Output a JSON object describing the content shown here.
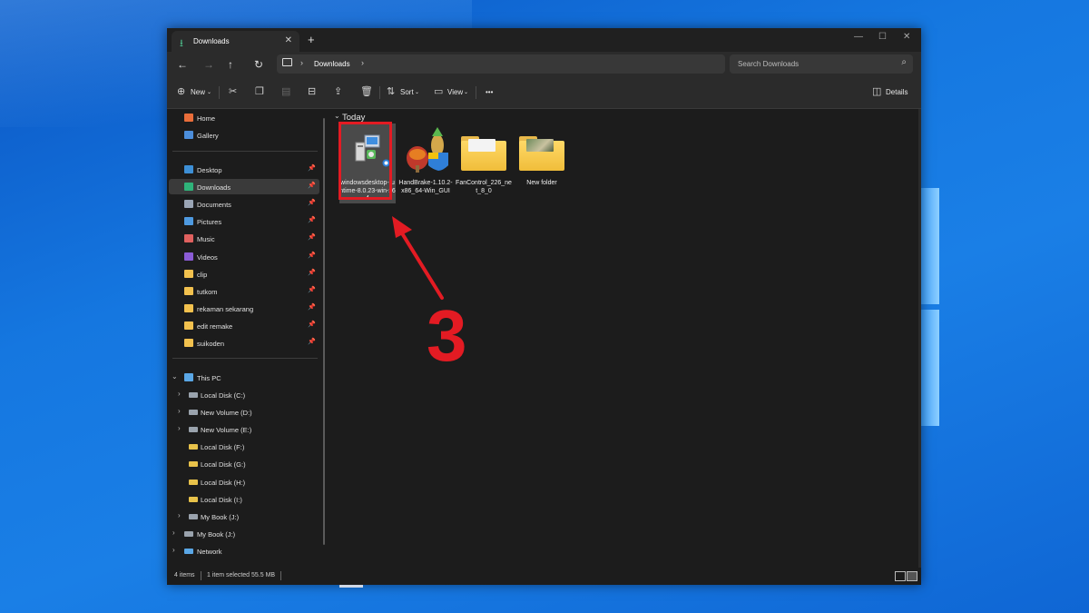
{
  "window": {
    "tab_title": "Downloads",
    "new_tab_glyph": "+",
    "close_glyph": "✕"
  },
  "address": {
    "location": "Downloads",
    "search_placeholder": "Search Downloads"
  },
  "commands": {
    "new_label": "New",
    "sort_label": "Sort",
    "view_label": "View",
    "more_glyph": "•••",
    "details_label": "Details"
  },
  "sidebar": {
    "top": [
      {
        "label": "Home",
        "icon": "home-icon",
        "color": "#e96d3a"
      },
      {
        "label": "Gallery",
        "icon": "gallery-icon",
        "color": "#4c8edb"
      }
    ],
    "quick": [
      {
        "label": "Desktop",
        "icon": "desktop-icon",
        "color": "#3d8fd6"
      },
      {
        "label": "Downloads",
        "icon": "download-icon",
        "color": "#2fb37a",
        "selected": true
      },
      {
        "label": "Documents",
        "icon": "documents-icon",
        "color": "#9aa5b5"
      },
      {
        "label": "Pictures",
        "icon": "pictures-icon",
        "color": "#4e9ae0"
      },
      {
        "label": "Music",
        "icon": "music-icon",
        "color": "#e0615f"
      },
      {
        "label": "Videos",
        "icon": "videos-icon",
        "color": "#8b5cd6"
      },
      {
        "label": "clip",
        "icon": "folder-icon",
        "color": "#f2c14e"
      },
      {
        "label": "tutkom",
        "icon": "folder-icon",
        "color": "#f2c14e"
      },
      {
        "label": "rekaman sekarang",
        "icon": "folder-icon",
        "color": "#f2c14e"
      },
      {
        "label": "edit remake",
        "icon": "folder-icon",
        "color": "#f2c14e"
      },
      {
        "label": "suikoden",
        "icon": "folder-icon",
        "color": "#f2c14e"
      }
    ],
    "this_pc": "This PC",
    "drives": [
      {
        "label": "Local Disk (C:)",
        "icon": "drive-icon",
        "expandable": true
      },
      {
        "label": "New Volume (D:)",
        "icon": "drive-icon",
        "expandable": true
      },
      {
        "label": "New Volume (E:)",
        "icon": "drive-icon",
        "expandable": true
      },
      {
        "label": "Local Disk (F:)",
        "icon": "locked-drive-icon",
        "expandable": false
      },
      {
        "label": "Local Disk (G:)",
        "icon": "locked-drive-icon",
        "expandable": false
      },
      {
        "label": "Local Disk (H:)",
        "icon": "locked-drive-icon",
        "expandable": false
      },
      {
        "label": "Local Disk (I:)",
        "icon": "locked-drive-icon",
        "expandable": false
      },
      {
        "label": "My Book (J:)",
        "icon": "drive-icon",
        "expandable": true
      }
    ],
    "bottom": [
      {
        "label": "My Book (J:)",
        "icon": "drive-icon"
      },
      {
        "label": "Network",
        "icon": "network-icon"
      }
    ]
  },
  "content": {
    "group_label": "Today",
    "files": [
      {
        "name": "windowsdesktop-runtime-8.0.23-win-x64",
        "icon": "installer-icon",
        "selected": true
      },
      {
        "name": "HandBrake-1.10.2-x86_64-Win_GUI",
        "icon": "handbrake-icon",
        "selected": false
      },
      {
        "name": "FanControl_226_net_8_0",
        "icon": "folder-icon",
        "selected": false
      },
      {
        "name": "New folder",
        "icon": "folder-icon",
        "selected": false
      }
    ]
  },
  "status": {
    "item_count": "4 items",
    "selection": "1 item selected  55.5 MB"
  },
  "annotation": {
    "step_number": "3",
    "color": "#e31b23"
  }
}
